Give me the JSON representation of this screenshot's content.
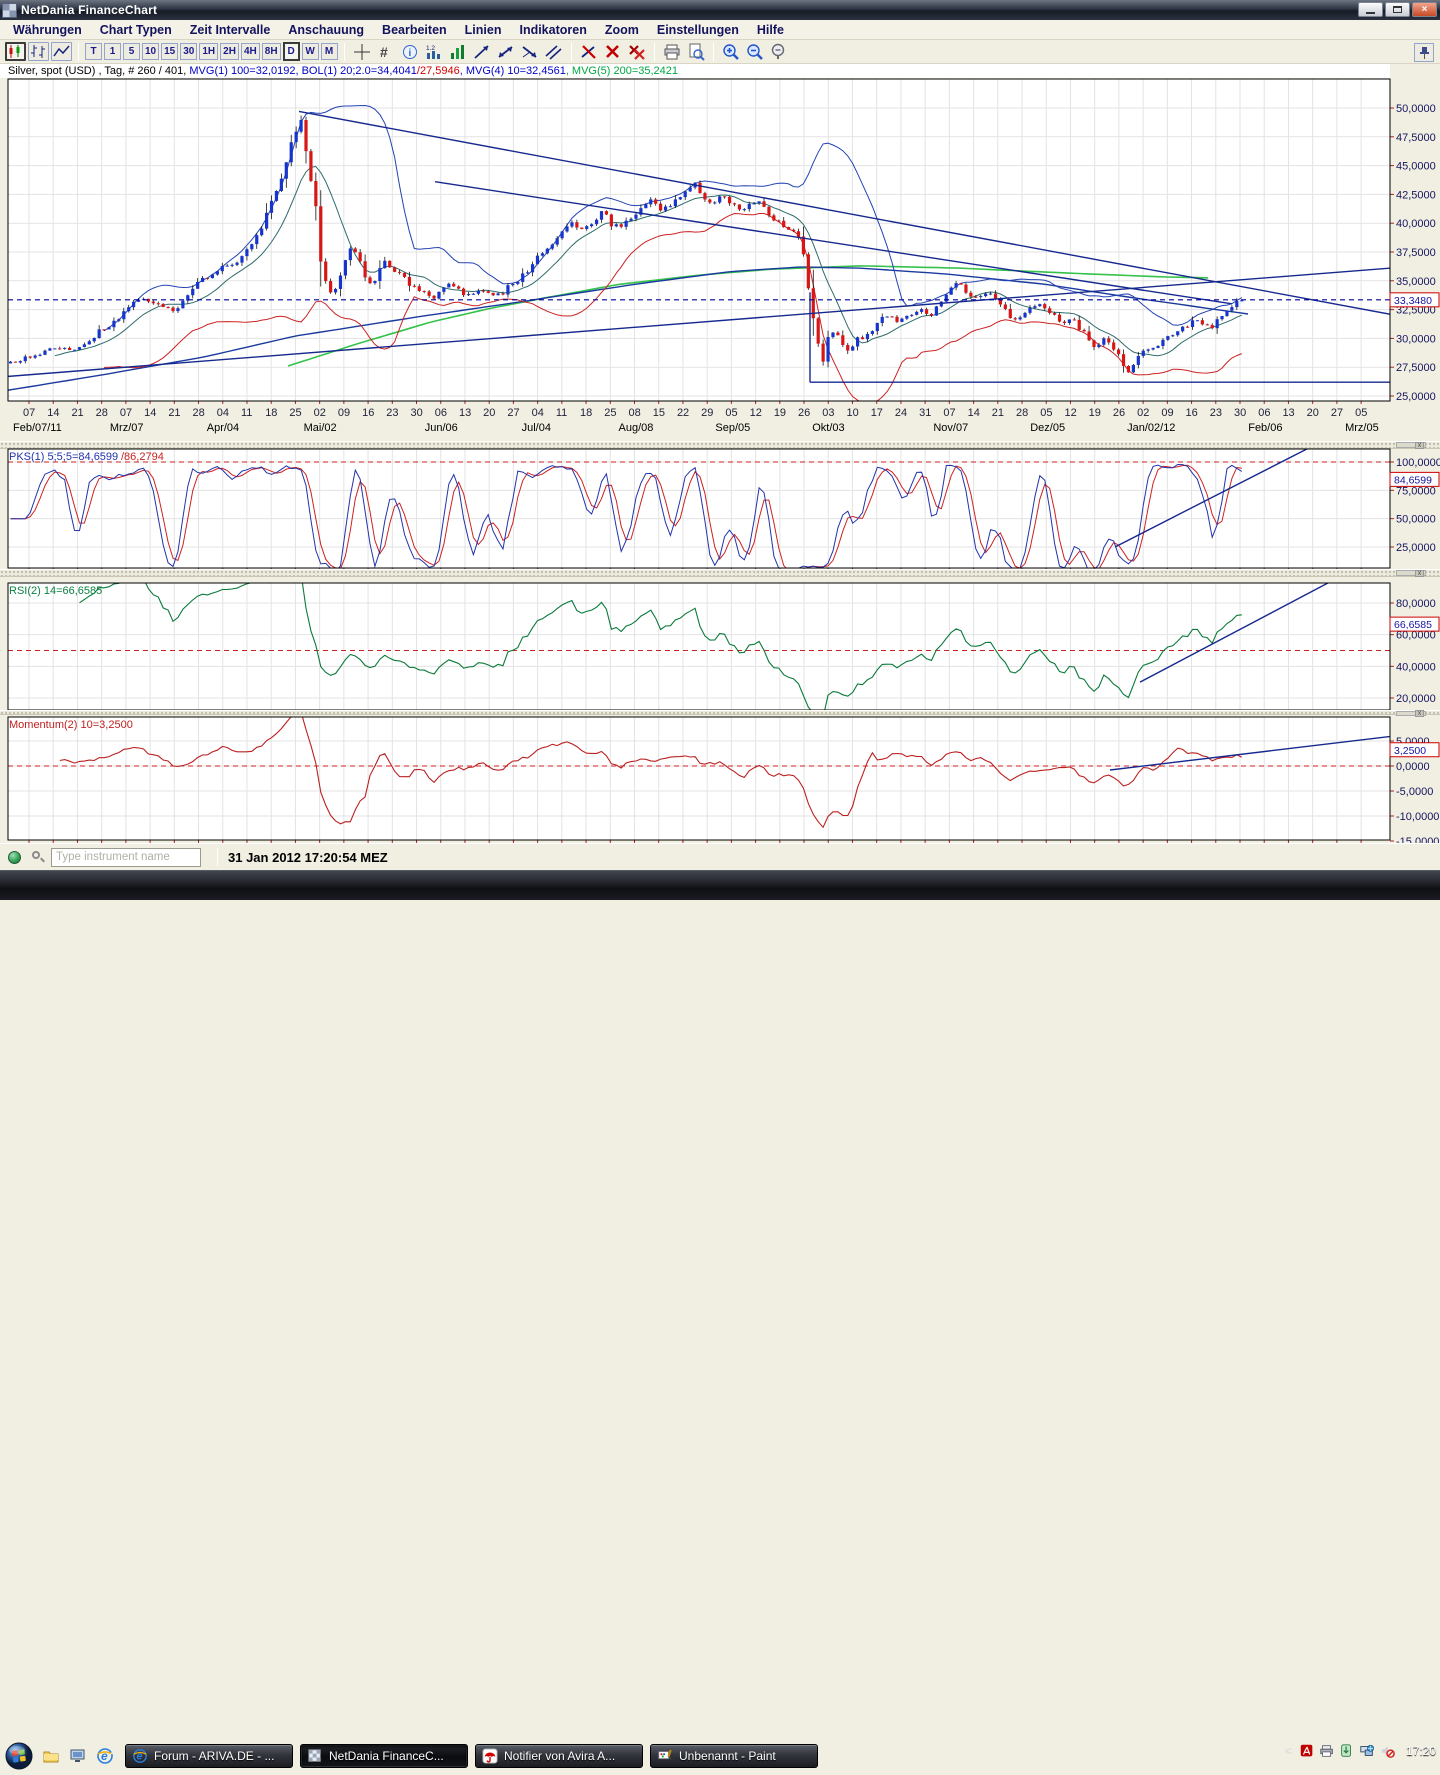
{
  "window": {
    "title": "NetDania FinanceChart",
    "controls": [
      "minimize",
      "maximize",
      "close"
    ]
  },
  "menu": {
    "items": [
      "Währungen",
      "Chart Typen",
      "Zeit Intervalle",
      "Anschauung",
      "Bearbeiten",
      "Linien",
      "Indikatoren",
      "Zoom",
      "Einstellungen",
      "Hilfe"
    ]
  },
  "toolbar": {
    "chart_type_icons": [
      "candlestick-chart",
      "ohlc-chart",
      "line-chart"
    ],
    "intervals": [
      "T",
      "1",
      "5",
      "10",
      "15",
      "30",
      "1H",
      "2H",
      "4H",
      "8H",
      "D",
      "W",
      "M"
    ],
    "active_interval": "D",
    "tools": [
      "crosshair",
      "grid",
      "info",
      "indicator-settings",
      "volume-histogram",
      "trendline",
      "trendline-segment",
      "trendline-ray",
      "trendline-channel",
      "delete-trendline",
      "delete-selected",
      "delete-all",
      "print",
      "print-preview",
      "zoom-in",
      "zoom-out",
      "zoom-reset"
    ],
    "pin": "pin"
  },
  "legend": {
    "segments": [
      {
        "text": "Silver, spot (USD) , Tag, # 260 / 401, ",
        "color": "#000000"
      },
      {
        "text": "MVG(1) 100=32,0192, BOL(1) 20;2.0=34,4041",
        "color": "#0000c8"
      },
      {
        "text": "/27,5946",
        "color": "#d40000"
      },
      {
        "text": ", MVG(4) 10=32,4561",
        "color": "#0000c8"
      },
      {
        "text": ", MVG(5) 200=35,2421",
        "color": "#00a844"
      }
    ]
  },
  "status_bar": {
    "connection_icon": "connected",
    "search_placeholder": "Type instrument name",
    "datetime": "31 Jan 2012 17:20:54 MEZ"
  },
  "taskbar": {
    "start": "Start",
    "quick_launch": [
      "folder",
      "show-desktop",
      "internet-explorer"
    ],
    "overflow_chevron": "»",
    "buttons": [
      {
        "label": "Forum - ARIVA.DE - ...",
        "icon": "internet-explorer",
        "active": false
      },
      {
        "label": "NetDania FinanceC...",
        "icon": "netdania",
        "active": true
      },
      {
        "label": "Notifier von Avira A...",
        "icon": "avira",
        "active": false
      },
      {
        "label": "Unbenannt - Paint",
        "icon": "paint",
        "active": false
      }
    ],
    "tray": {
      "chevron": "<",
      "icons": [
        "adobe-reader",
        "printer",
        "removable-device",
        "network",
        "volume-muted"
      ],
      "clock": "17:20"
    }
  },
  "chart_data": [
    {
      "type": "candlestick",
      "instrument": "Silver, spot (USD)",
      "period": "Tag",
      "bars_shown": 260,
      "bars_total": 401,
      "ylim": [
        24.5,
        52.5
      ],
      "yticks": [
        50,
        47.5,
        45,
        42.5,
        40,
        37.5,
        35,
        32.5,
        30,
        27.5,
        25
      ],
      "current_price": 33.348,
      "current_price_label": "33,3480",
      "overlays": {
        "mvg100": "32,0192",
        "bol_upper": "34,4041",
        "bol_lower": "27,5946",
        "mvg10": "32,4561",
        "mvg200": "35,2421"
      },
      "close_anchors": [
        [
          8,
          27.9
        ],
        [
          30,
          28.4
        ],
        [
          55,
          29.2
        ],
        [
          75,
          29.0
        ],
        [
          100,
          30.6
        ],
        [
          120,
          31.8
        ],
        [
          140,
          33.6
        ],
        [
          160,
          33.0
        ],
        [
          175,
          32.4
        ],
        [
          195,
          34.5
        ],
        [
          210,
          35.6
        ],
        [
          228,
          36.3
        ],
        [
          242,
          37.0
        ],
        [
          258,
          38.9
        ],
        [
          272,
          41.8
        ],
        [
          283,
          44.0
        ],
        [
          292,
          46.8
        ],
        [
          299,
          49.2
        ],
        [
          303,
          48.0
        ],
        [
          309,
          44.5
        ],
        [
          315,
          41.0
        ],
        [
          322,
          36.5
        ],
        [
          328,
          34.2
        ],
        [
          334,
          33.6
        ],
        [
          343,
          35.8
        ],
        [
          352,
          38.2
        ],
        [
          360,
          37.0
        ],
        [
          368,
          34.8
        ],
        [
          376,
          35.3
        ],
        [
          385,
          36.6
        ],
        [
          394,
          35.9
        ],
        [
          403,
          35.2
        ],
        [
          412,
          34.6
        ],
        [
          420,
          34.3
        ],
        [
          428,
          33.7
        ],
        [
          436,
          33.5
        ],
        [
          444,
          34.4
        ],
        [
          452,
          34.9
        ],
        [
          460,
          33.9
        ],
        [
          468,
          33.7
        ],
        [
          478,
          34.3
        ],
        [
          490,
          33.9
        ],
        [
          500,
          33.8
        ],
        [
          510,
          34.6
        ],
        [
          520,
          35.2
        ],
        [
          532,
          36.4
        ],
        [
          545,
          37.6
        ],
        [
          558,
          38.9
        ],
        [
          570,
          40.1
        ],
        [
          580,
          39.6
        ],
        [
          592,
          39.9
        ],
        [
          602,
          41.0
        ],
        [
          612,
          39.9
        ],
        [
          622,
          39.7
        ],
        [
          632,
          40.7
        ],
        [
          642,
          41.4
        ],
        [
          652,
          42.0
        ],
        [
          660,
          41.2
        ],
        [
          670,
          41.6
        ],
        [
          680,
          42.3
        ],
        [
          690,
          43.2
        ],
        [
          697,
          43.4
        ],
        [
          704,
          42.2
        ],
        [
          712,
          41.8
        ],
        [
          722,
          42.4
        ],
        [
          730,
          41.6
        ],
        [
          740,
          41.2
        ],
        [
          750,
          41.6
        ],
        [
          760,
          41.8
        ],
        [
          768,
          40.9
        ],
        [
          776,
          40.2
        ],
        [
          784,
          39.8
        ],
        [
          792,
          39.5
        ],
        [
          800,
          38.8
        ],
        [
          806,
          36.0
        ],
        [
          812,
          32.8
        ],
        [
          818,
          30.2
        ],
        [
          823,
          27.8
        ],
        [
          828,
          29.8
        ],
        [
          834,
          30.8
        ],
        [
          840,
          29.6
        ],
        [
          846,
          28.6
        ],
        [
          852,
          29.4
        ],
        [
          858,
          30.2
        ],
        [
          864,
          29.8
        ],
        [
          872,
          30.8
        ],
        [
          880,
          31.6
        ],
        [
          890,
          31.9
        ],
        [
          900,
          31.4
        ],
        [
          910,
          32.1
        ],
        [
          920,
          32.6
        ],
        [
          930,
          31.8
        ],
        [
          940,
          33.0
        ],
        [
          950,
          34.3
        ],
        [
          958,
          34.8
        ],
        [
          966,
          34.1
        ],
        [
          974,
          33.6
        ],
        [
          982,
          33.9
        ],
        [
          990,
          34.0
        ],
        [
          998,
          33.4
        ],
        [
          1006,
          32.2
        ],
        [
          1014,
          31.4
        ],
        [
          1022,
          32.3
        ],
        [
          1030,
          32.6
        ],
        [
          1040,
          32.9
        ],
        [
          1048,
          32.4
        ],
        [
          1056,
          31.8
        ],
        [
          1064,
          31.3
        ],
        [
          1072,
          31.6
        ],
        [
          1080,
          30.9
        ],
        [
          1088,
          29.8
        ],
        [
          1096,
          29.2
        ],
        [
          1104,
          29.9
        ],
        [
          1112,
          29.1
        ],
        [
          1120,
          28.3
        ],
        [
          1127,
          26.9
        ],
        [
          1133,
          27.6
        ],
        [
          1140,
          28.6
        ],
        [
          1148,
          28.9
        ],
        [
          1156,
          29.4
        ],
        [
          1164,
          29.9
        ],
        [
          1172,
          30.4
        ],
        [
          1180,
          30.8
        ],
        [
          1188,
          31.1
        ],
        [
          1196,
          31.7
        ],
        [
          1204,
          31.3
        ],
        [
          1212,
          30.9
        ],
        [
          1220,
          31.8
        ],
        [
          1228,
          32.4
        ],
        [
          1236,
          33.0
        ],
        [
          1242,
          33.2
        ],
        [
          1248,
          33.5
        ],
        [
          1252,
          33.3
        ],
        [
          1256,
          33.35
        ]
      ],
      "sma100_anchors": [
        [
          8,
          25.5
        ],
        [
          100,
          26.8
        ],
        [
          205,
          28.4
        ],
        [
          295,
          30.2
        ],
        [
          420,
          31.9
        ],
        [
          515,
          33.1
        ],
        [
          635,
          34.7
        ],
        [
          730,
          35.8
        ],
        [
          800,
          36.2
        ],
        [
          860,
          36.1
        ],
        [
          945,
          35.6
        ],
        [
          1045,
          34.7
        ],
        [
          1135,
          33.5
        ],
        [
          1256,
          32.02
        ]
      ],
      "mvg200_anchors": [
        [
          288,
          27.6
        ],
        [
          360,
          29.6
        ],
        [
          430,
          31.4
        ],
        [
          490,
          32.6
        ],
        [
          550,
          33.6
        ],
        [
          620,
          34.7
        ],
        [
          700,
          35.5
        ],
        [
          770,
          36.0
        ],
        [
          860,
          36.3
        ],
        [
          960,
          36.1
        ],
        [
          1060,
          35.7
        ],
        [
          1160,
          35.35
        ],
        [
          1215,
          35.24
        ]
      ],
      "trendlines": [
        [
          8,
          26.7,
          1390,
          36.1
        ],
        [
          299,
          49.7,
          1390,
          32.1
        ],
        [
          435,
          43.6,
          1232,
          33.0
        ],
        [
          810,
          34.0,
          810,
          26.2
        ],
        [
          810,
          26.2,
          1390,
          26.2
        ]
      ],
      "x_weeks": [
        "07",
        "14",
        "21",
        "28",
        "07",
        "14",
        "21",
        "28",
        "04",
        "11",
        "18",
        "25",
        "02",
        "09",
        "16",
        "23",
        "30",
        "06",
        "13",
        "20",
        "27",
        "04",
        "11",
        "18",
        "25",
        "08",
        "15",
        "22",
        "29",
        "05",
        "12",
        "19",
        "26",
        "03",
        "10",
        "17",
        "24",
        "31",
        "07",
        "14",
        "21",
        "28",
        "05",
        "12",
        "19",
        "26",
        "02",
        "09",
        "16",
        "23",
        "30",
        "06",
        "13",
        "20",
        "27",
        "05"
      ],
      "x_months": [
        {
          "label": "Feb/07/11",
          "week": 0
        },
        {
          "label": "Mrz/07",
          "week": 4
        },
        {
          "label": "Apr/04",
          "week": 8
        },
        {
          "label": "Mai/02",
          "week": 12
        },
        {
          "label": "Jun/06",
          "week": 17
        },
        {
          "label": "Jul/04",
          "week": 21
        },
        {
          "label": "Aug/08",
          "week": 25
        },
        {
          "label": "Sep/05",
          "week": 29
        },
        {
          "label": "Okt/03",
          "week": 33
        },
        {
          "label": "Nov/07",
          "week": 38
        },
        {
          "label": "Dez/05",
          "week": 42
        },
        {
          "label": "Jan/02/12",
          "week": 46
        },
        {
          "label": "Feb/06",
          "week": 51
        },
        {
          "label": "Mrz/05",
          "week": 55
        }
      ]
    },
    {
      "type": "line",
      "name": "PKS",
      "title_blue": "PKS(1) 5;5;5=84,6599",
      "title_red": "/86,2794",
      "value_blue": "84,6599",
      "value_red": "86,2794",
      "yticks": [
        100,
        75,
        50,
        25
      ],
      "dashed_level": 100,
      "current_label": "84,6599",
      "current_value": 84.6599,
      "trendline": [
        1115,
        25,
        1308,
        112
      ],
      "series_source": "stochastic(5;5;5) of price"
    },
    {
      "type": "line",
      "name": "RSI",
      "title": "RSI(2) 14=66,6585",
      "value": "66,6585",
      "yticks": [
        80,
        60,
        40,
        20
      ],
      "dashed_level": 50,
      "current_label": "66,6585",
      "current_value": 66.6585,
      "trendline": [
        1140,
        30,
        1335,
        95
      ],
      "series_source": "RSI(14) of price"
    },
    {
      "type": "line",
      "name": "Momentum",
      "title": "Momentum(2) 10=3,2500",
      "value": "3,2500",
      "yticks": [
        5,
        0,
        -5,
        -10,
        -15
      ],
      "dashed_level": 0,
      "current_label": "3,2500",
      "current_value": 3.25,
      "trendline": [
        1110,
        -0.8,
        1390,
        5.9
      ],
      "series_source": "momentum(10) of price"
    }
  ]
}
